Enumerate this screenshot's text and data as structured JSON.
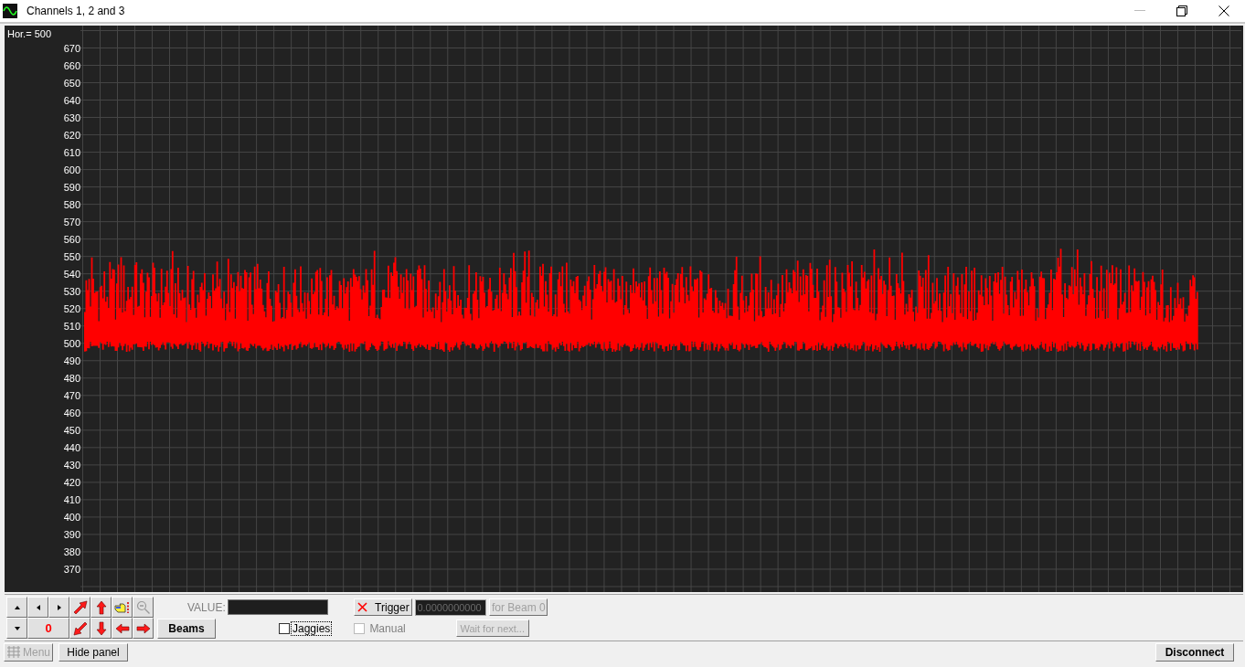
{
  "window": {
    "title": "Channels 1, 2 and 3"
  },
  "scope": {
    "horizontal_label": "Hor.= 500",
    "y_ticks": [
      "670",
      "660",
      "650",
      "640",
      "630",
      "620",
      "610",
      "600",
      "590",
      "580",
      "570",
      "560",
      "550",
      "540",
      "530",
      "520",
      "510",
      "500",
      "490",
      "480",
      "470",
      "460",
      "450",
      "440",
      "430",
      "420",
      "410",
      "400",
      "390",
      "380",
      "370"
    ]
  },
  "panel": {
    "counter": "0",
    "beams_button": "Beams",
    "value_label": "VALUE:",
    "jaggies": {
      "label": "Jaggies",
      "checked": false
    },
    "trigger_button": "Trigger",
    "trigger_field": {
      "value": "0.0000000000",
      "disabled": true
    },
    "for_beam_button": {
      "label": "for Beam 0",
      "disabled": true
    },
    "manual": {
      "label": "Manual",
      "checked": false,
      "disabled": true
    },
    "wait_button": {
      "label": "Wait for next...",
      "disabled": true
    }
  },
  "bottom_bar": {
    "menu_button": {
      "label": "Menu",
      "disabled": true
    },
    "hide_panel_button": "Hide panel",
    "disconnect_button": "Disconnect"
  }
}
